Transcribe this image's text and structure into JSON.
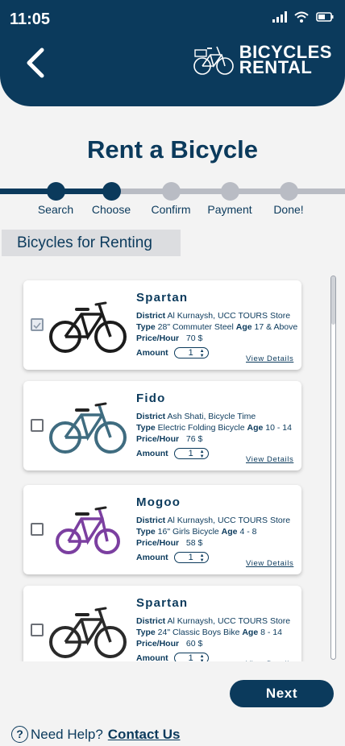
{
  "status": {
    "time": "11:05"
  },
  "header": {
    "logo_line1": "BICYCLES",
    "logo_line2": "RENTAL"
  },
  "page_title": "Rent a Bicycle",
  "steps": [
    "Search",
    "Choose",
    "Confirm",
    "Payment",
    "Done!"
  ],
  "current_step": 2,
  "section_title": "Bicycles for Renting",
  "labels": {
    "district": "District",
    "store": "Store",
    "type": "Type",
    "age": "Age",
    "price": "Price/Hour",
    "amount": "Amount",
    "view_details": "View Details",
    "currency": "$"
  },
  "bikes": [
    {
      "name": "Spartan",
      "district": "Al Kurnaysh,",
      "store": "UCC TOURS Store",
      "type": "28\" Commuter Steel",
      "age": "17 & Above",
      "price": "70",
      "amount": "1",
      "checked": true,
      "color": "#1c1c1c"
    },
    {
      "name": "Fido",
      "district": "Ash Shati, Bicycle Time",
      "store": "",
      "type": "Electric Folding Bicycle",
      "age": "10 - 14",
      "price": "76",
      "amount": "1",
      "checked": false,
      "color": "#3f6c80"
    },
    {
      "name": "Mogoo",
      "district": "Al Kurnaysh,",
      "store": "UCC TOURS Store",
      "type": "16\" Girls Bicycle",
      "age": "4 - 8",
      "price": "58",
      "amount": "1",
      "checked": false,
      "color": "#7b3fa0"
    },
    {
      "name": "Spartan",
      "district": "Al Kurnaysh,",
      "store": "UCC TOURS Store",
      "type": "24\" Classic Boys Bike",
      "age": "8 - 14",
      "price": "60",
      "amount": "1",
      "checked": false,
      "color": "#2a2a2a"
    }
  ],
  "next_button": "Next",
  "help": {
    "text": "Need Help?",
    "link": "Contact Us"
  },
  "colors": {
    "primary": "#0b3a5c",
    "inactive": "#b9bcc4",
    "background": "#f3f3f3"
  }
}
